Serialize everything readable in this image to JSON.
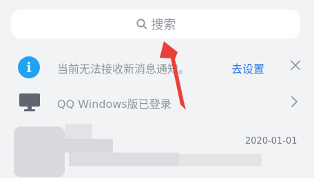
{
  "search": {
    "label": "搜索",
    "icon": "search-icon"
  },
  "notice": {
    "text": "当前无法接收新消息通知。",
    "action_label": "去设置",
    "icon": "info-icon",
    "close_icon": "close-icon",
    "accent": "#20a3f0",
    "link_color": "#2979e6"
  },
  "login_status": {
    "text": "QQ Windows版已登录",
    "icon": "monitor-icon",
    "chevron": "chevron-right-icon"
  },
  "chat": {
    "date": "2020-01-01"
  },
  "annotation": {
    "color": "#e8413a"
  }
}
